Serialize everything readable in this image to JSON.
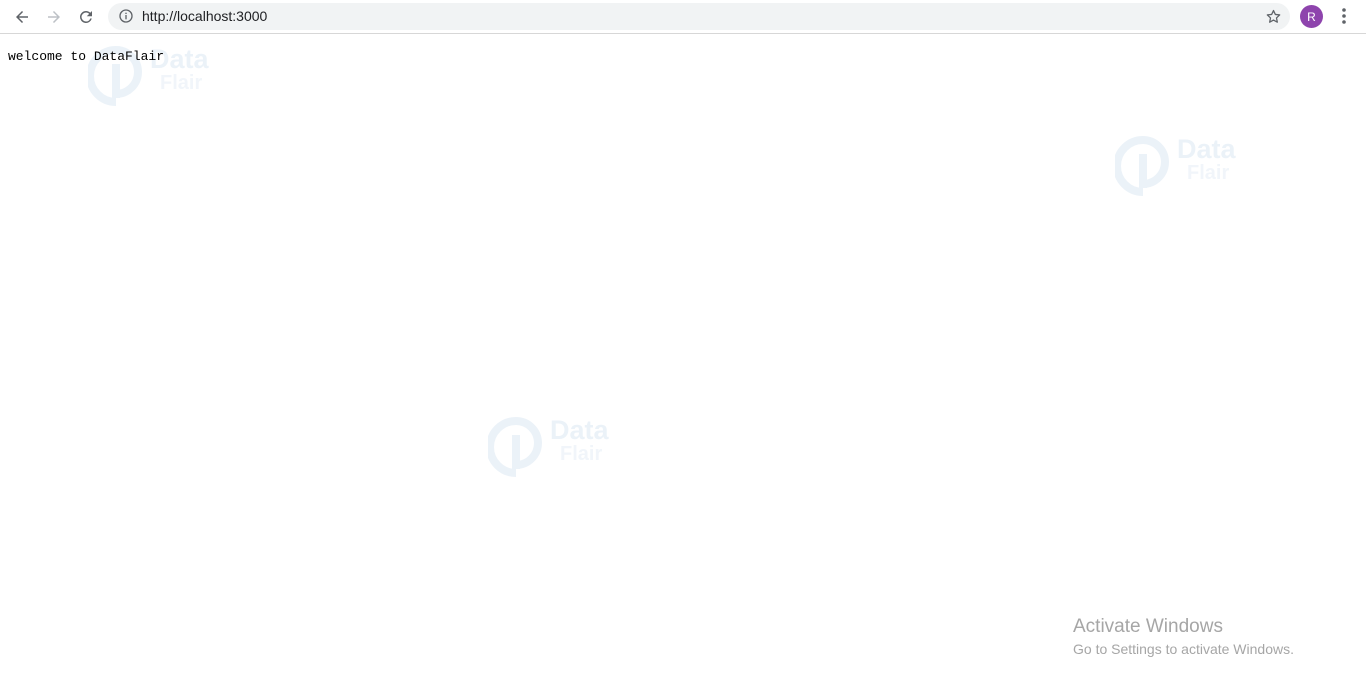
{
  "browser": {
    "url": "http://localhost:3000",
    "avatar_initial": "R",
    "accent_color": "#8e44ad"
  },
  "page": {
    "welcome_text": "welcome to DataFlair"
  },
  "watermark": {
    "line1": "Data",
    "line2": "Flair"
  },
  "os_notice": {
    "title": "Activate Windows",
    "subtitle": "Go to Settings to activate Windows."
  },
  "icons": {
    "back": "arrow-left-icon",
    "forward": "arrow-right-icon",
    "reload": "reload-icon",
    "info": "info-icon",
    "bookmark": "star-icon",
    "menu": "kebab-menu-icon"
  }
}
